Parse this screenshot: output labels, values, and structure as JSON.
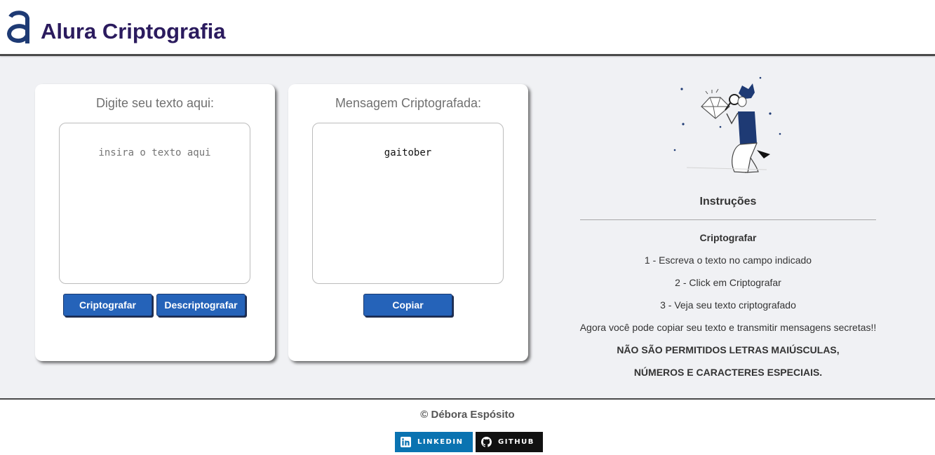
{
  "header": {
    "title": "Alura Criptografia",
    "logo_icon": "alura-logo-icon"
  },
  "encrypt_card": {
    "title": "Digite seu texto aqui:",
    "input_placeholder": "insira o texto aqui",
    "input_value": "",
    "encrypt_label": "Criptografar",
    "decrypt_label": "Descriptografar"
  },
  "output_card": {
    "title": "Mensagem Criptografada:",
    "output_value": "gaitober",
    "copy_label": "Copiar"
  },
  "instructions": {
    "title": "Instruções",
    "subtitle": "Criptografar",
    "step1": "1 - Escreva o texto no campo indicado",
    "step2": "2 - Click em Criptografar",
    "step3": "3 - Veja seu texto criptografado",
    "note": "Agora você pode copiar seu texto e transmitir mensagens secretas!!",
    "warning1": "NÃO SÃO PERMITIDOS LETRAS MAIÚSCULAS,",
    "warning2": "NÚMEROS E CARACTERES ESPECIAIS."
  },
  "footer": {
    "copyright": "© Débora Espósito",
    "linkedin_label": "LINKEDIN",
    "github_label": "GITHUB"
  },
  "colors": {
    "accent": "#2563b9",
    "title": "#2b1b5e",
    "linkedin": "#0a73b1",
    "github": "#111111"
  }
}
